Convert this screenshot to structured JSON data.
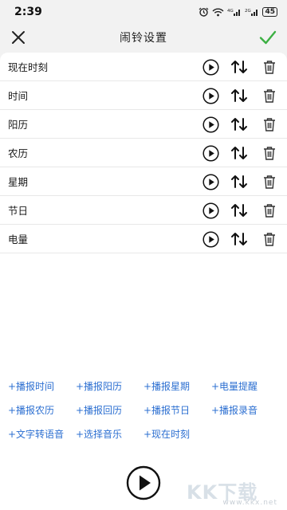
{
  "status_bar": {
    "time": "2:39",
    "battery": "45",
    "signal1": "4G",
    "signal2": "2G"
  },
  "header": {
    "title": "闹铃设置",
    "close_icon": "close-icon",
    "confirm_icon": "check-icon",
    "accent_color": "#3cb043"
  },
  "items": [
    {
      "label": "现在时刻"
    },
    {
      "label": "时间"
    },
    {
      "label": "阳历"
    },
    {
      "label": "农历"
    },
    {
      "label": "星期"
    },
    {
      "label": "节日"
    },
    {
      "label": "电量"
    }
  ],
  "row_icons": [
    "play-icon",
    "sort-icon",
    "trash-icon"
  ],
  "tags": [
    "+播报时间",
    "+播报阳历",
    "+播报星期",
    "+电量提醒",
    "+播报农历",
    "+播报回历",
    "+播报节日",
    "+播报录音",
    "+文字转语音",
    "+选择音乐",
    "+现在时刻"
  ],
  "tag_color": "#2c6fd1",
  "watermark": {
    "text": "KK下载",
    "url": "www.kkx.net"
  }
}
